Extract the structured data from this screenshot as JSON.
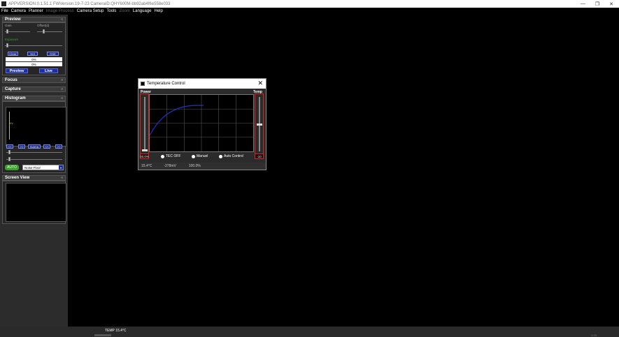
{
  "window": {
    "title": "APPVERSION:0.1.51.1  FWVersion:19-7-23  CameraID:QHY600M-bb92ab4f6e558e033",
    "min_glyph": "—",
    "max_glyph": "❐",
    "close_glyph": "✕"
  },
  "menu": {
    "items": [
      "File",
      "Camera",
      "Planner",
      "Image Process",
      "Camera Setup",
      "Tools",
      "Zoom",
      "Language",
      "Help"
    ]
  },
  "preview": {
    "header": "Preview",
    "arrow": "«",
    "gain_label": "Gain",
    "offset_label": "Offset(d)",
    "exposure_label": "Exposure",
    "buttons": [
      "Clear",
      "Set",
      "Oritr"
    ],
    "progress1": "0%",
    "progress2": "0%",
    "preview_btn": "Preview",
    "live_btn": "Live"
  },
  "focus": {
    "header": "Focus",
    "arrow": "»"
  },
  "capture": {
    "header": "Capture",
    "arrow": "»"
  },
  "histogram": {
    "header": "Histogram",
    "arrow": "«",
    "y_label": "0V",
    "nav_buttons": [
      "<<",
      ">>",
      "Gama",
      "<<",
      ">>"
    ],
    "auto_btn": "AUTO",
    "noise_select": "Noise Floor",
    "dropdown_glyph": "▾"
  },
  "screen_view": {
    "header": "Screen View",
    "arrow": "«"
  },
  "temp_dialog": {
    "title": "Temperature Control",
    "close": "✕",
    "power_label": "Power",
    "temp_label": "Temp",
    "power_value": "00.0%",
    "temp_value": "-10",
    "radios": [
      "TEC OFF",
      "Manuel",
      "Auto Control"
    ],
    "status_temp": "15.4°C",
    "status_mv": "-278mV",
    "status_pct": "100.0%",
    "power_level_pct": 0,
    "temp_level_fraction": 0.5
  },
  "status_bar": {
    "temp_text": "TEMP  15.4°C",
    "right_text": "0:33"
  },
  "colors": {
    "accent_blue": "#1d2fa8",
    "red_frame": "#e02020",
    "auto_green": "#3ea02e",
    "curve": "#2233bb"
  }
}
